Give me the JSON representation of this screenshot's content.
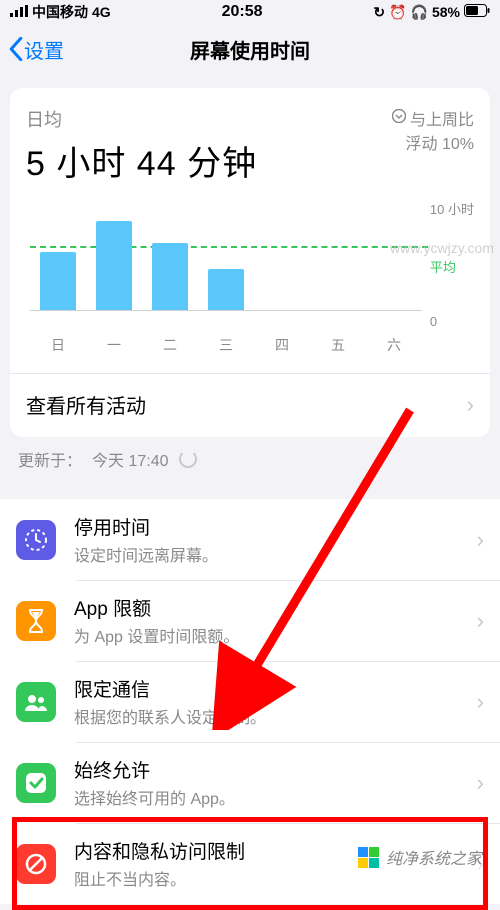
{
  "status": {
    "carrier": "中国移动",
    "network": "4G",
    "time": "20:58",
    "battery": "58%"
  },
  "nav": {
    "back": "设置",
    "title": "屏幕使用时间"
  },
  "summary": {
    "avg_label": "日均",
    "avg_value": "5 小时 44 分钟",
    "trend_label": "与上周比",
    "trend_value": "浮动 10%"
  },
  "chart_data": {
    "type": "bar",
    "categories": [
      "日",
      "一",
      "二",
      "三",
      "四",
      "五",
      "六"
    ],
    "values": [
      5.2,
      8.0,
      6.0,
      3.7,
      0,
      0,
      0
    ],
    "ylim": [
      0,
      10
    ],
    "y_ticks": [
      "10 小时",
      "0"
    ],
    "avg_line_label": "平均",
    "avg_line_value": 5.73,
    "title": "",
    "xlabel": "",
    "ylabel": ""
  },
  "view_all": "查看所有活动",
  "updated": {
    "prefix": "更新于：",
    "value": "今天 17:40"
  },
  "options": [
    {
      "icon": "downtime",
      "color": "#5e5ce6",
      "title": "停用时间",
      "sub": "设定时间远离屏幕。"
    },
    {
      "icon": "hourglass",
      "color": "#ff9500",
      "title": "App 限额",
      "sub": "为 App 设置时间限额。"
    },
    {
      "icon": "contacts",
      "color": "#34c759",
      "title": "限定通信",
      "sub": "根据您的联系人设定限制。"
    },
    {
      "icon": "check",
      "color": "#34c759",
      "title": "始终允许",
      "sub": "选择始终可用的 App。"
    },
    {
      "icon": "nosign",
      "color": "#ff3b30",
      "title": "内容和隐私访问限制",
      "sub": "阻止不当内容。"
    }
  ],
  "watermark": {
    "site": "纯净系统之家",
    "url": "www.ycwjzy.com"
  }
}
